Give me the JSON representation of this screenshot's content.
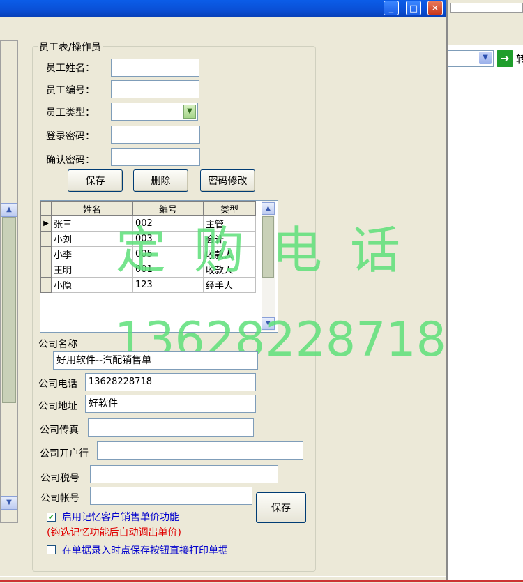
{
  "window": {
    "min_symbol": "_",
    "max_symbol": "□",
    "close_symbol": "✕"
  },
  "right_panel": {
    "go_symbol": "➔",
    "truncated_text": "转"
  },
  "group": {
    "title": "员工表/操作员"
  },
  "employee_form": {
    "name_label": "员工姓名：",
    "id_label": "员工编号：",
    "type_label": "员工类型：",
    "password_label": "登录密码：",
    "confirm_label": "确认密码：",
    "name_value": "",
    "id_value": "",
    "type_value": "",
    "password_value": "",
    "confirm_value": "",
    "save_label": "保存",
    "delete_label": "删除",
    "change_password_label": "密码修改"
  },
  "grid": {
    "columns": [
      "姓名",
      "编号",
      "类型"
    ],
    "rows": [
      {
        "name": "张三",
        "id": "002",
        "type": "主管"
      },
      {
        "name": "小刘",
        "id": "003",
        "type": "会计"
      },
      {
        "name": "小李",
        "id": "005",
        "type": "收款人"
      },
      {
        "name": "王明",
        "id": "001",
        "type": "收款人"
      },
      {
        "name": "小隐",
        "id": "123",
        "type": "经手人"
      }
    ],
    "current_row_marker": "▶"
  },
  "watermark": {
    "text_cn": "定购电话",
    "phone": "13628228718"
  },
  "company": {
    "name_label": "公司名称",
    "name_value": "好用软件--汽配销售单",
    "phone_label": "公司电话",
    "phone_value": "13628228718",
    "address_label": "公司地址",
    "address_value": "好软件",
    "fax_label": "公司传真",
    "fax_value": "",
    "bank_label": "公司开户行",
    "bank_value": "",
    "tax_label": "公司税号",
    "tax_value": "",
    "account_label": "公司帐号",
    "account_value": "",
    "save_label": "保存"
  },
  "options": {
    "remember_price_label": "启用记忆客户销售单价功能",
    "remember_price_checked": true,
    "remember_price_hint": "(钩选记忆功能后自动调出单价)",
    "print_on_save_label": "在单据录入时点保存按钮直接打印单据",
    "print_on_save_checked": false
  },
  "colors": {
    "titlebar": "#0a4fd6",
    "watermark": "#5ee07a",
    "checkbox_label": "#0000cc",
    "hint": "#e00000"
  }
}
